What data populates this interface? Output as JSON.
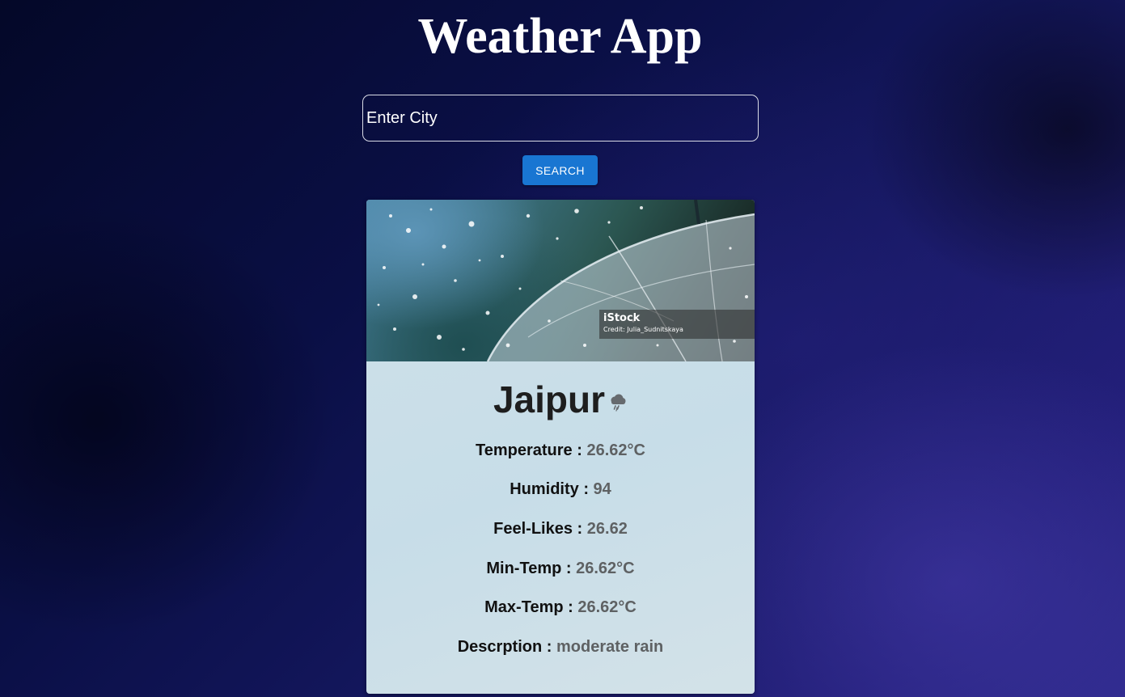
{
  "app": {
    "title": "Weather App"
  },
  "search": {
    "placeholder": "Enter City",
    "button_label": "SEARCH"
  },
  "card": {
    "image": {
      "brand": "iStock",
      "credit": "Credit: Julia_Sudnitskaya"
    },
    "city": "Jaipur",
    "weather_icon": "rain-cloud-icon",
    "stats": [
      {
        "label": "Temperature :",
        "value": "26.62°C"
      },
      {
        "label": "Humidity :",
        "value": "94"
      },
      {
        "label": "Feel-Likes :",
        "value": "26.62"
      },
      {
        "label": "Min-Temp :",
        "value": "26.62°C"
      },
      {
        "label": "Max-Temp :",
        "value": "26.62°C"
      },
      {
        "label": "Descrption :",
        "value": "moderate rain"
      }
    ]
  },
  "colors": {
    "button": "#1976d2",
    "card_background": "#cde0e8",
    "value_text": "#5e6163"
  }
}
